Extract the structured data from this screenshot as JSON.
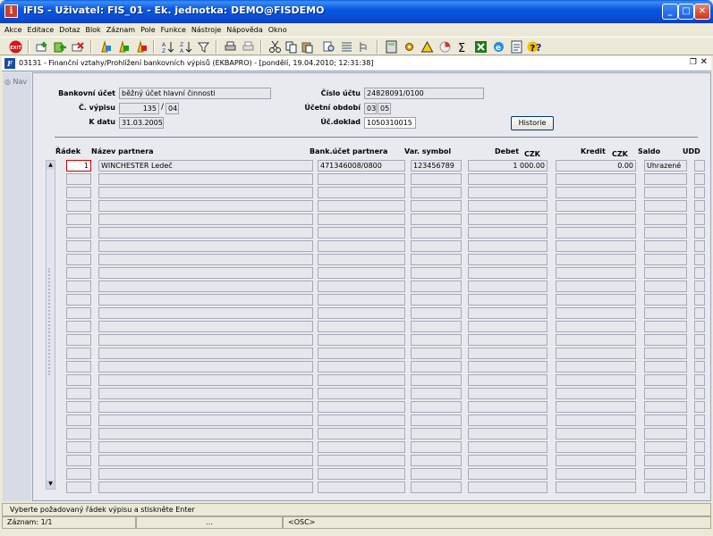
{
  "window": {
    "icon_letter": "i",
    "title": "iFIS - Uživatel: FIS_01 - Ek. jednotka: DEMO@FISDEMO",
    "minimize": "_",
    "maximize": "□",
    "close": "✕"
  },
  "menu": [
    "Akce",
    "Editace",
    "Dotaz",
    "Blok",
    "Záznam",
    "Pole",
    "Funkce",
    "Nástroje",
    "Nápověda",
    "Okno"
  ],
  "toolbar": {
    "exit_label": "EXIT",
    "icons": [
      "exit-icon",
      "new-record-icon",
      "insert-record-icon",
      "delete-record-icon",
      "enter-query-icon",
      "execute-query-icon",
      "cancel-query-icon",
      "sort-asc-icon",
      "sort-desc-icon",
      "filter-icon",
      "print-icon",
      "print-setup-icon",
      "cut-icon",
      "copy-icon",
      "paste-icon",
      "find-icon",
      "list-icon",
      "tree-icon",
      "calculator-icon",
      "settings-icon",
      "warning-icon",
      "chart-icon",
      "sum-icon",
      "excel-icon",
      "internet-icon",
      "notes-icon",
      "help-icon",
      "context-help-icon"
    ]
  },
  "document": {
    "icon_letter": "F",
    "title": "03131 - Finanční vztahy/Prohlížení bankovních výpisů (EKBAPRO) - [pondělí, 19.04.2010; 12:31:38]",
    "restore": "❐",
    "close": "✕"
  },
  "nav": {
    "label": "Nav"
  },
  "header": {
    "bankovni_ucet_label": "Bankovní účet",
    "bankovni_ucet_value": "běžný účet hlavní činnosti",
    "c_vypisu_label": "Č. výpisu",
    "c_vypisu_value": "135",
    "c_vypisu_sep": "/",
    "c_vypisu_suffix": "04",
    "k_datu_label": "K datu",
    "k_datu_value": "31.03.2005",
    "cislo_uctu_label": "Číslo účtu",
    "cislo_uctu_value": "24828091/0100",
    "ucetni_obdobi_label": "Účetní období",
    "ucetni_obdobi_year": "03",
    "ucetni_obdobi_month": "05",
    "uc_doklad_label": "Úč.doklad",
    "uc_doklad_value": "1050310015",
    "historie_button": "Historie"
  },
  "columns": {
    "radek": "Řádek",
    "nazev_partnera": "Název partnera",
    "bank_ucet_partnera": "Bank.účet partnera",
    "var_symbol": "Var. symbol",
    "debet": "Debet",
    "debet_currency": "CZK",
    "kredit": "Kredit",
    "kredit_currency": "CZK",
    "saldo": "Saldo",
    "udd": "UDD"
  },
  "rows": [
    {
      "radek": "1",
      "nazev": "WINCHESTER Ledeč",
      "bank_ucet": "471346008/0800",
      "var_symbol": "123456789",
      "debet": "1 000.00",
      "kredit": "0.00",
      "saldo": "Uhrazené",
      "udd": ""
    }
  ],
  "empty_row_count": 24,
  "scroll": {
    "up": "▲",
    "down": "▼"
  },
  "status": {
    "message": "Vyberte požadovaný řádek výpisu a stiskněte Enter",
    "record": "Záznam: 1/1",
    "ellipsis": "...",
    "mode": "<OSC>"
  }
}
